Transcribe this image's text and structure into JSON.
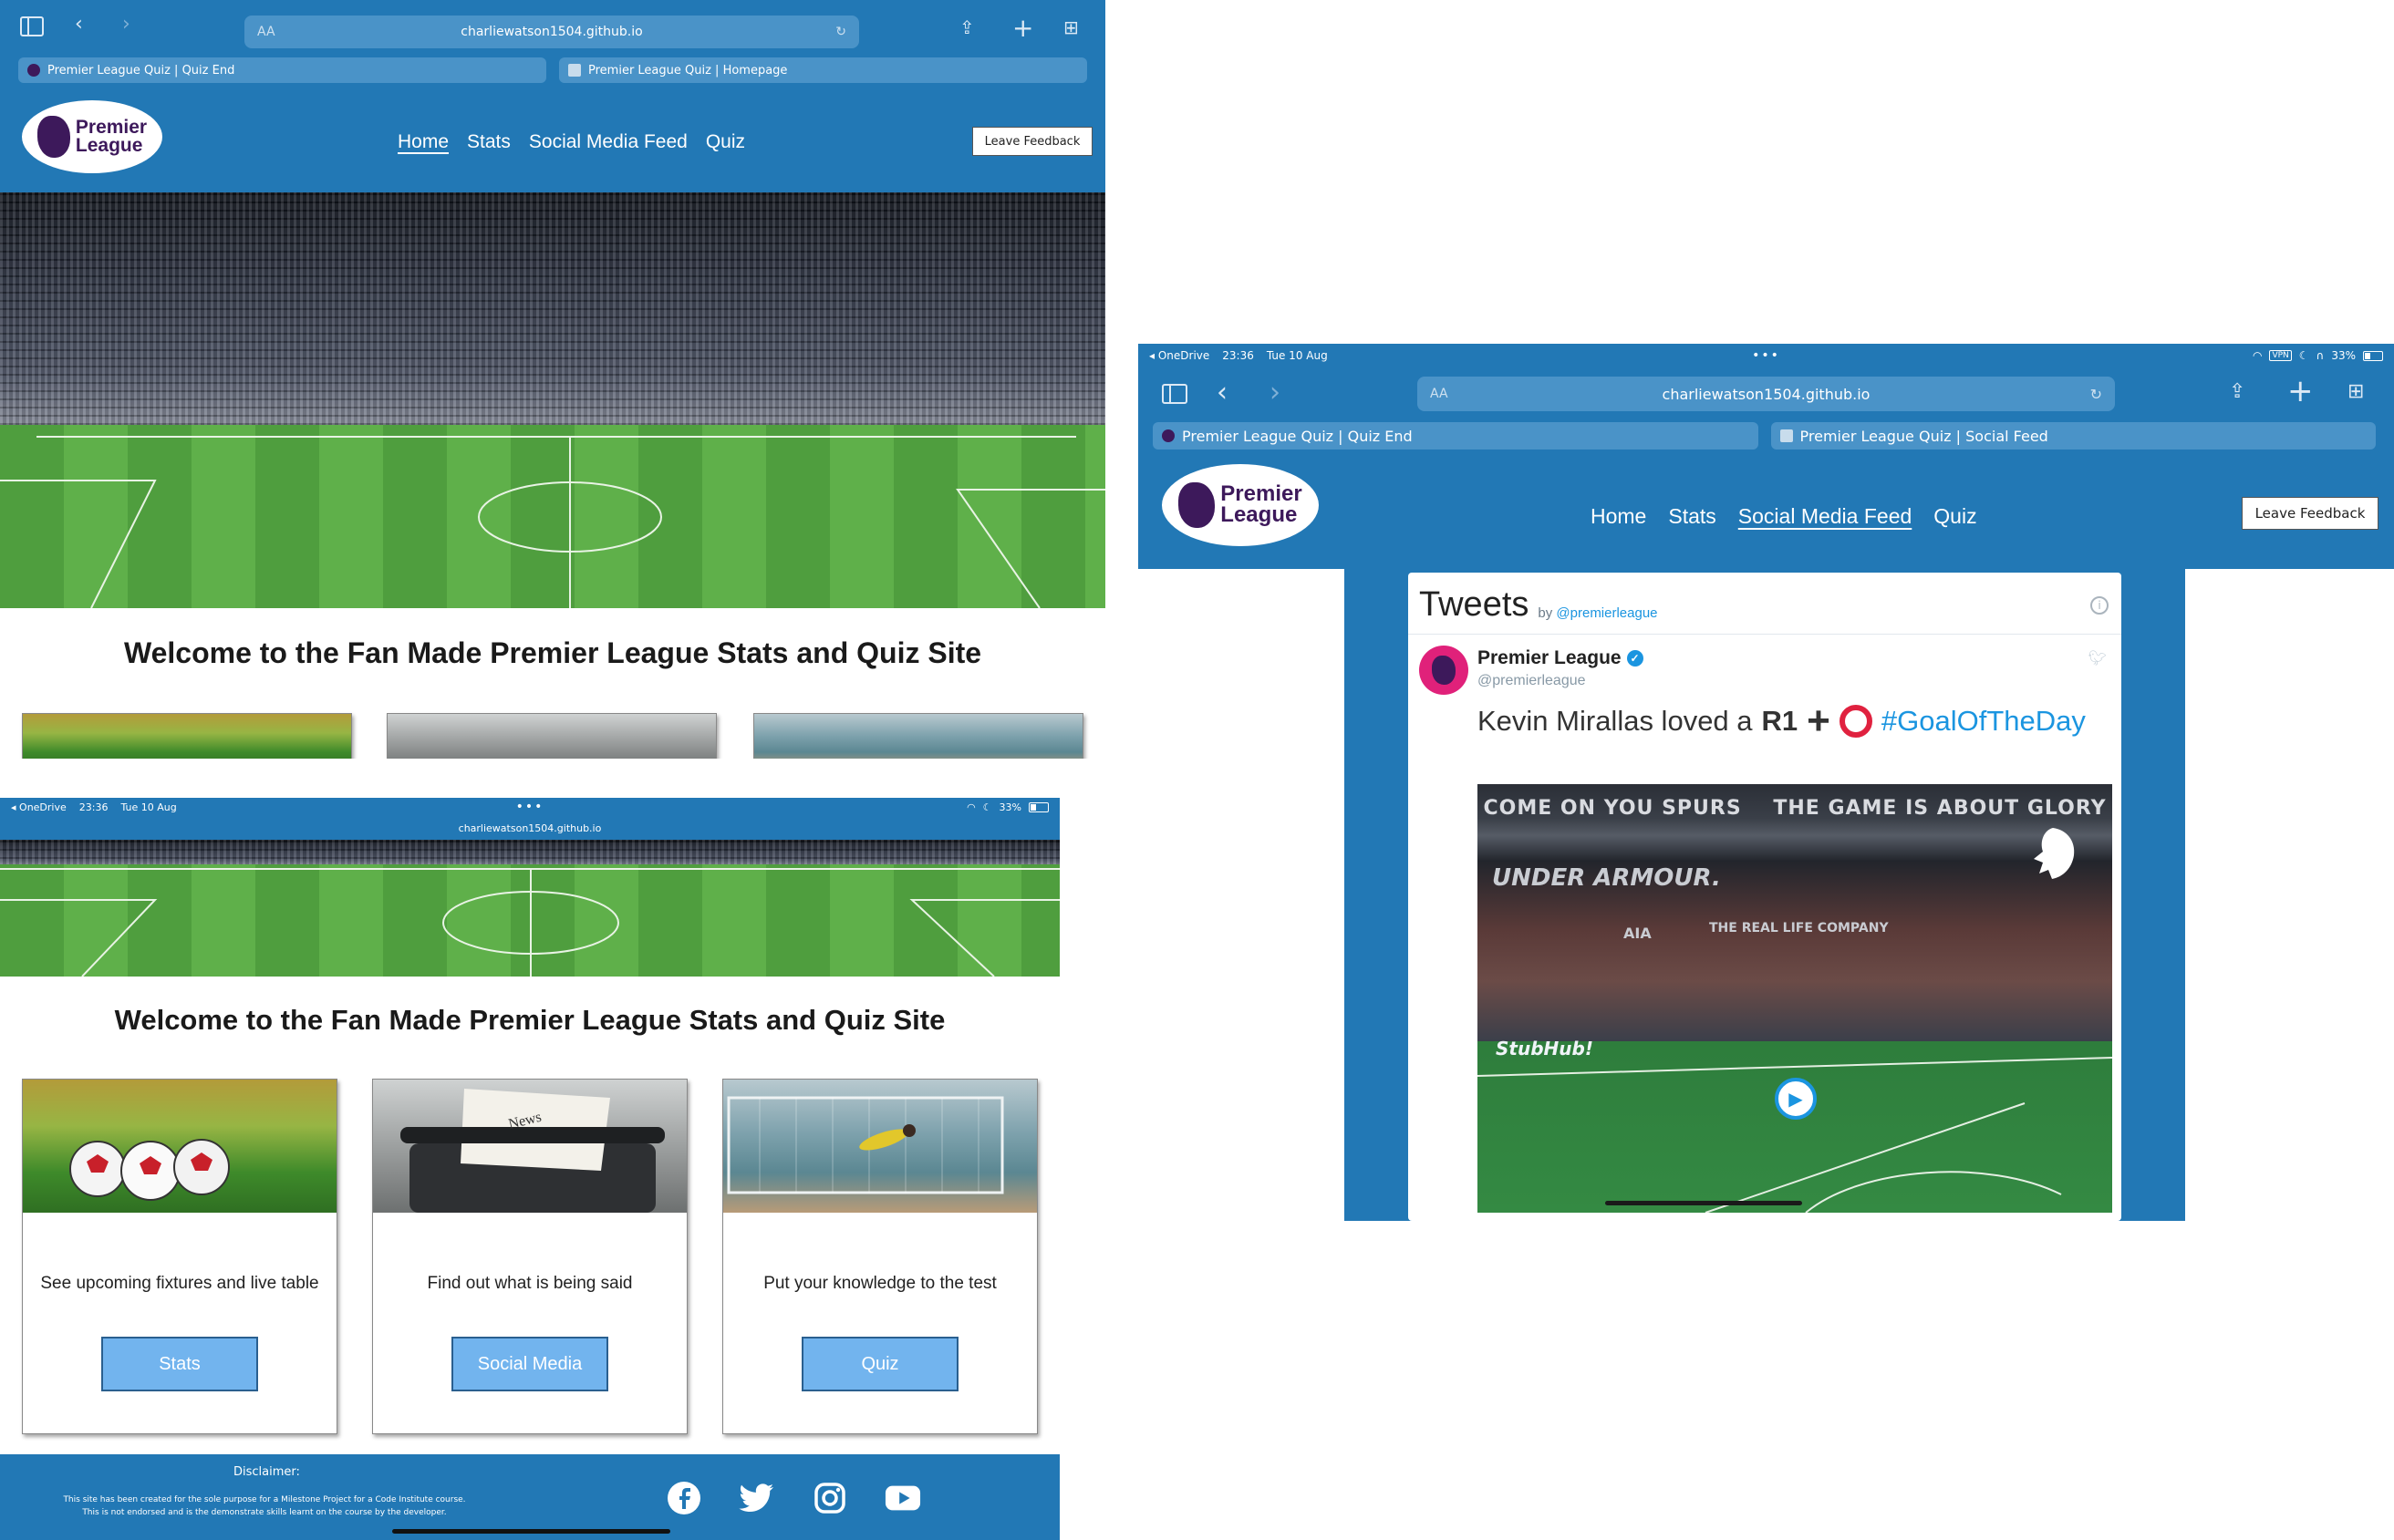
{
  "colors": {
    "site_blue": "#2278b5",
    "button_blue": "#72b4ee",
    "pl_purple": "#3d195b",
    "twitter_blue": "#1b95e0"
  },
  "status": {
    "app": "OneDrive",
    "time": "23:36",
    "date": "Tue 10 Aug",
    "battery": "33%"
  },
  "browser": {
    "url": "charliewatson1504.github.io",
    "aa": "AA",
    "tab_quiz_end": "Premier League Quiz | Quiz End",
    "tab_home": "Premier League Quiz | Homepage",
    "tab_social": "Premier League Quiz | Social Feed"
  },
  "logo": {
    "line1": "Premier",
    "line2": "League"
  },
  "nav": {
    "home": "Home",
    "stats": "Stats",
    "social": "Social Media Feed",
    "quiz": "Quiz",
    "feedback": "Leave Feedback"
  },
  "welcome": "Welcome to the Fan Made Premier League Stats and Quiz Site",
  "cards": [
    {
      "text": "See upcoming fixtures and live table",
      "button": "Stats",
      "image": "footballs-on-grass"
    },
    {
      "text": "Find out what is being said",
      "button": "Social Media",
      "image": "typewriter-news"
    },
    {
      "text": "Put your knowledge to the test",
      "button": "Quiz",
      "image": "goalkeeper-diving"
    }
  ],
  "typewriter_word": "News",
  "footer": {
    "disclaimer_title": "Disclaimer:",
    "disclaimer_line1": "This site has been created for the sole purpose for a Milestone Project for a Code Institute course.",
    "disclaimer_line2": "This is not endorsed and is the demonstrate skills learnt on the course by the developer.",
    "social_icons": [
      "facebook-icon",
      "twitter-icon",
      "instagram-icon",
      "youtube-icon"
    ]
  },
  "tweets": {
    "title": "Tweets",
    "by": "by",
    "by_handle": "@premierleague",
    "author": "Premier League",
    "handle": "@premierleague",
    "text_start": "Kevin Mirallas loved a",
    "r1": "R1",
    "hashtag": "#GoalOfTheDay",
    "video_banner_1": "COME ON YOU SPURS",
    "video_banner_2": "THE GAME IS ABOUT GLORY",
    "video_ad_1": "UNDER ARMOUR.",
    "video_ad_2": "AIA",
    "video_ad_3": "THE REAL LIFE COMPANY",
    "video_ad_4": "StubHub!"
  }
}
